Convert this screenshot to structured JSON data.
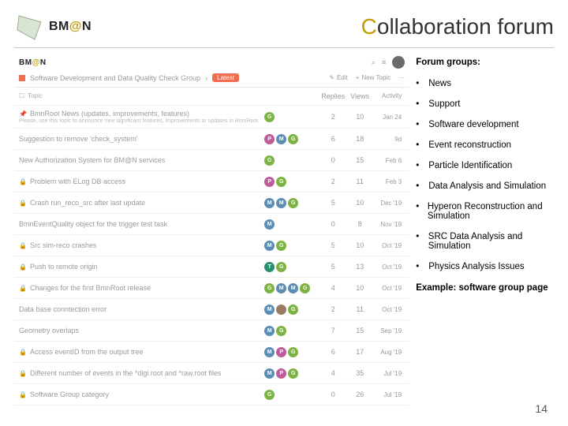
{
  "header": {
    "logo_text_a": "BM",
    "logo_text_b": "@",
    "logo_text_c": "N",
    "title_first": "C",
    "title_rest": "ollaboration forum"
  },
  "shot": {
    "logo_a": "BM",
    "logo_b": "@",
    "logo_c": "N",
    "category": "Software Development and Data Quality Check Group",
    "pill": "Latest",
    "toolbar": {
      "edit": "Edit",
      "newtopic": "New Topic"
    },
    "thead": {
      "topic": "Topic",
      "replies": "Replies",
      "views": "Views",
      "activity": "Activity"
    },
    "rows": [
      {
        "lock": false,
        "pin": true,
        "title": "BmnRoot News (updates, improvements, features)",
        "sub": "Please, use this topic to announce new significant features, improvements or updates in BmnRoot",
        "users": [
          [
            "G",
            "#7cb342"
          ]
        ],
        "replies": "2",
        "views": "10",
        "activity": "Jan 24"
      },
      {
        "lock": false,
        "pin": false,
        "title": "Suggestion to remove 'check_system'",
        "users": [
          [
            "P",
            "#c05b9a"
          ],
          [
            "M",
            "#5c8db5"
          ],
          [
            "G",
            "#7cb342"
          ]
        ],
        "replies": "6",
        "views": "18",
        "activity": "9d"
      },
      {
        "lock": false,
        "pin": false,
        "title": "New Authorization System for BM@N services",
        "users": [
          [
            "G",
            "#7cb342"
          ]
        ],
        "replies": "0",
        "views": "15",
        "activity": "Feb 6"
      },
      {
        "lock": true,
        "pin": false,
        "title": "Problem with ELog DB access",
        "users": [
          [
            "P",
            "#c05b9a"
          ],
          [
            "G",
            "#7cb342"
          ]
        ],
        "replies": "2",
        "views": "11",
        "activity": "Feb 3"
      },
      {
        "lock": true,
        "pin": false,
        "title": "Crash run_reco_src after last update",
        "users": [
          [
            "M",
            "#5c8db5"
          ],
          [
            "M",
            "#5c8db5"
          ],
          [
            "G",
            "#7cb342"
          ]
        ],
        "replies": "5",
        "views": "10",
        "activity": "Dec '19"
      },
      {
        "lock": false,
        "pin": false,
        "title": "BmnEventQuality object for the trigger test task",
        "users": [
          [
            "M",
            "#5c8db5"
          ]
        ],
        "replies": "0",
        "views": "8",
        "activity": "Nov '19"
      },
      {
        "lock": true,
        "pin": false,
        "title": "Src sim-reco crashes",
        "users": [
          [
            "M",
            "#5c8db5"
          ],
          [
            "G",
            "#7cb342"
          ]
        ],
        "replies": "5",
        "views": "10",
        "activity": "Oct '19"
      },
      {
        "lock": true,
        "pin": false,
        "title": "Push to remote origin",
        "users": [
          [
            "T",
            "#2a8f6f"
          ],
          [
            "G",
            "#7cb342"
          ]
        ],
        "replies": "5",
        "views": "13",
        "activity": "Oct '19"
      },
      {
        "lock": true,
        "pin": false,
        "title": "Changes for the first BmnRoot release",
        "users": [
          [
            "G",
            "#7cb342"
          ],
          [
            "M",
            "#5c8db5"
          ],
          [
            "M",
            "#5c8db5"
          ],
          [
            "G",
            "#7cb342"
          ]
        ],
        "replies": "4",
        "views": "10",
        "activity": "Oct '19"
      },
      {
        "lock": false,
        "pin": false,
        "title": "Data base conntection error",
        "users": [
          [
            "M",
            "#5c8db5"
          ],
          [
            "",
            "#9a7b66"
          ],
          [
            "G",
            "#7cb342"
          ]
        ],
        "replies": "2",
        "views": "11",
        "activity": "Oct '19"
      },
      {
        "lock": false,
        "pin": false,
        "title": "Geometry overlaps",
        "users": [
          [
            "M",
            "#5c8db5"
          ],
          [
            "G",
            "#7cb342"
          ]
        ],
        "replies": "7",
        "views": "15",
        "activity": "Sep '19"
      },
      {
        "lock": true,
        "pin": false,
        "title": "Access eventID from the output tree",
        "users": [
          [
            "M",
            "#5c8db5"
          ],
          [
            "P",
            "#c05b9a"
          ],
          [
            "G",
            "#7cb342"
          ]
        ],
        "replies": "6",
        "views": "17",
        "activity": "Aug '19"
      },
      {
        "lock": true,
        "pin": false,
        "title": "Different number of events in the *digi.root and *raw.root files",
        "users": [
          [
            "M",
            "#5c8db5"
          ],
          [
            "P",
            "#c05b9a"
          ],
          [
            "G",
            "#7cb342"
          ]
        ],
        "replies": "4",
        "views": "35",
        "activity": "Jul '19"
      },
      {
        "lock": true,
        "pin": false,
        "title": "Software Group category",
        "users": [
          [
            "G",
            "#7cb342"
          ]
        ],
        "replies": "0",
        "views": "26",
        "activity": "Jul '19"
      }
    ]
  },
  "side": {
    "title": "Forum groups:",
    "items": [
      "News",
      "Support",
      "Software development",
      "Event reconstruction",
      "Particle Identification",
      "Data Analysis and Simulation",
      "Hyperon Reconstruction and Simulation",
      "SRC Data Analysis and Simulation",
      "Physics Analysis Issues"
    ],
    "caption": "Example: software group page"
  },
  "page_number": "14"
}
